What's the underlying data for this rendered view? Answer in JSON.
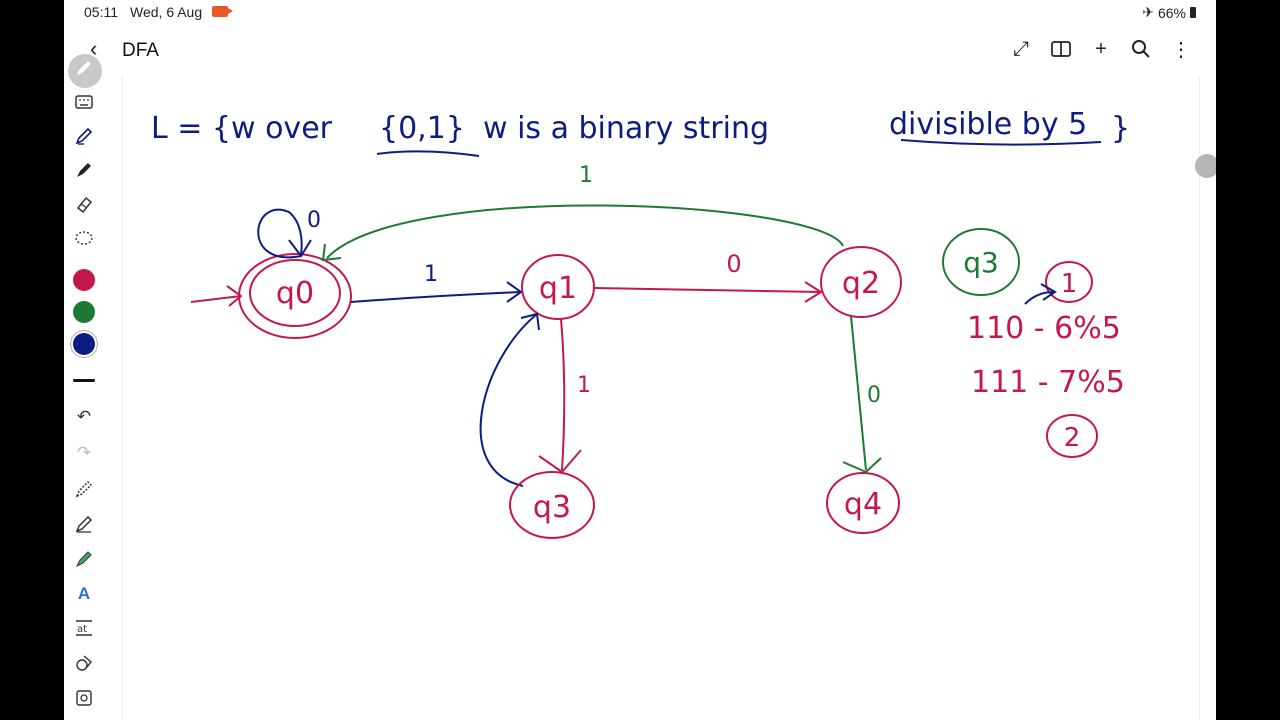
{
  "status_bar": {
    "time": "05:11",
    "date": "Wed, 6 Aug",
    "battery": "66%"
  },
  "toolbar": {
    "title": "DFA",
    "icons": [
      "back-icon",
      "expand-icon",
      "book-icon",
      "add-icon",
      "search-icon",
      "more-icon"
    ]
  },
  "tools": {
    "icons": [
      "pen-circle-icon",
      "keyboard-icon",
      "pen-icon",
      "marker-icon",
      "eraser-icon",
      "lasso-icon",
      "undo-icon",
      "redo-icon",
      "pen-settings-icon",
      "shape-pen-icon",
      "highlighter-icon",
      "text-icon",
      "text-format-icon",
      "shapes-icon",
      "image-icon"
    ],
    "colors": [
      "#c4184b",
      "#1c7a36",
      "#0d1c80"
    ]
  },
  "note": {
    "heading": {
      "prefix": "L = {w over",
      "alphabet": "{0,1}",
      "middle": "w is a binary string",
      "emphasis": "divisible by 5",
      "close": "}"
    },
    "states": [
      {
        "label": "q0",
        "final": true,
        "start": true
      },
      {
        "label": "q1"
      },
      {
        "label": "q2"
      },
      {
        "label": "q3"
      },
      {
        "label": "q4"
      }
    ],
    "transitions": [
      {
        "from": "q0",
        "to": "q0",
        "symbol": "0"
      },
      {
        "from": "q0",
        "to": "q1",
        "symbol": "1"
      },
      {
        "from": "q1",
        "to": "q2",
        "symbol": "0"
      },
      {
        "from": "q1",
        "to": "q3",
        "symbol": "1"
      },
      {
        "from": "q2",
        "to": "q0",
        "symbol": "1"
      },
      {
        "from": "q2",
        "to": "q4",
        "symbol": "0"
      },
      {
        "from": "q3",
        "to": "q1",
        "symbol": ""
      }
    ],
    "side_notes": {
      "circled_state": "q3",
      "mark_1": "1",
      "line_1": "110 - 6%5",
      "line_2": "111 - 7%5",
      "mark_2": "2"
    }
  },
  "colors": {
    "navy": "#0d1c80",
    "crimson": "#c4184b",
    "green": "#1c7a36"
  }
}
